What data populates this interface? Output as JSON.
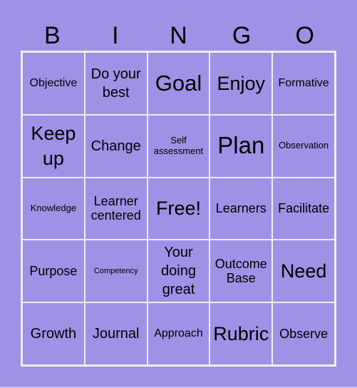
{
  "header": {
    "letters": [
      "B",
      "I",
      "N",
      "G",
      "O"
    ]
  },
  "colors": {
    "background": "#A091E6",
    "grid_lines": "#EEEEEE",
    "text": "#000000"
  },
  "board": {
    "rows": [
      [
        "Objective",
        "Do your best",
        "Goal",
        "Enjoy",
        "Formative"
      ],
      [
        "Keep up",
        "Change",
        "Self assessment",
        "Plan",
        "Observation"
      ],
      [
        "Knowledge",
        "Learner centered",
        "Free!",
        "Learners",
        "Facilitate"
      ],
      [
        "Purpose",
        "Competency",
        "Your doing great",
        "Outcome Base",
        "Need"
      ],
      [
        "Growth",
        "Journal",
        "Approach",
        "Rubric",
        "Observe"
      ]
    ]
  }
}
